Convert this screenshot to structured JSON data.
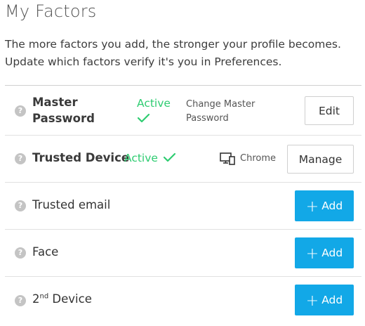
{
  "page": {
    "title": "My Factors",
    "intro": "The more factors you add, the stronger your profile becomes. Update which factors verify it's you in Preferences."
  },
  "factors": [
    {
      "name_line1": "Master",
      "name_line2": "Password",
      "status": "Active",
      "detail_line1": "Change Master",
      "detail_line2": "Password",
      "button": "Edit"
    },
    {
      "name": "Trusted Device",
      "status": "Active",
      "device": "Chrome",
      "device_icon": "desktop-mobile-icon",
      "button": "Manage"
    },
    {
      "name": "Trusted email",
      "button": "Add"
    },
    {
      "name": "Face",
      "button": "Add"
    },
    {
      "name_prefix": "2",
      "name_sup": "nd",
      "name_suffix": " Device",
      "button": "Add"
    }
  ],
  "help_icon_glyph": "?",
  "colors": {
    "active": "#2ecc71",
    "primary_button": "#12a8e7",
    "help_icon": "#c4c4c4"
  }
}
